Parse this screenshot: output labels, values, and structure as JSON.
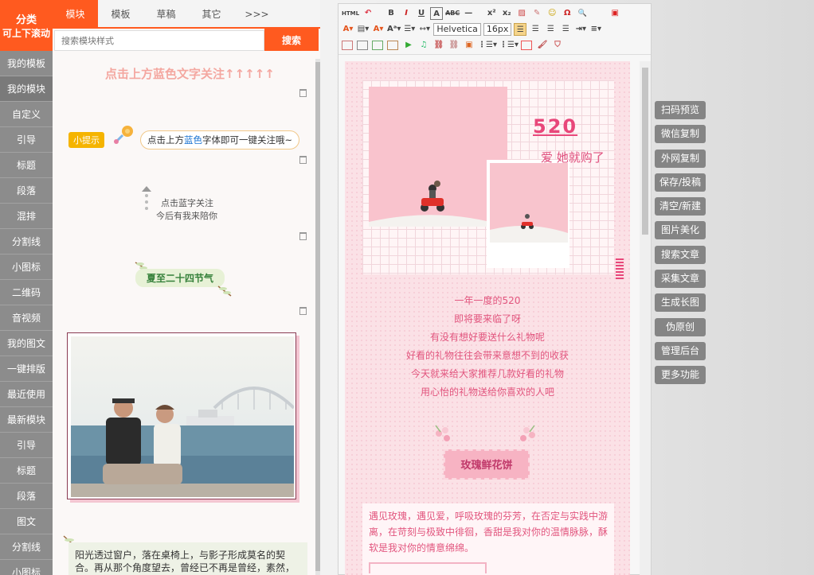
{
  "category": {
    "header_line1": "分类",
    "header_line2": "可上下滚动",
    "items": [
      "我的模板",
      "我的模块",
      "自定义",
      "引导",
      "标题",
      "段落",
      "混排",
      "分割线",
      "小图标",
      "二维码",
      "音视频",
      "我的图文",
      "一键排版",
      "最近使用",
      "最新模块",
      "引导",
      "标题",
      "段落",
      "图文",
      "分割线",
      "小图标"
    ]
  },
  "module_panel": {
    "tabs": [
      "模块",
      "模板",
      "草稿",
      "其它",
      ">>>"
    ],
    "search_placeholder": "搜索模块样式",
    "search_button": "搜索",
    "item1_text": "点击上方蓝色文字关注↑↑↑↑↑",
    "item2_badge": "小提示",
    "item2_pre": "点击上方",
    "item2_blue1": "蓝",
    "item2_blue2": "色",
    "item2_post": "字体即可一键关注哦~",
    "item3_line1": "点击蓝字关注",
    "item3_line2": "今后有我来陪你",
    "item4_text": "夏至二十四节气",
    "item6_text": "阳光透过窗户，落在桌椅上，与影子形成莫名的契合。再从那个角度望去，曾经已不再是曾经，素然，才想起自己已经长大了，回不去了。"
  },
  "editor": {
    "font_family": "Helvetica",
    "font_size": "16px",
    "toolbar_row1": [
      "HTML",
      "↶",
      "B",
      "I",
      "U",
      "A",
      "ABC",
      "—",
      "x²",
      "x₂",
      "▨",
      "✎",
      "☺",
      "Ω",
      "🔍"
    ],
    "article": {
      "num": "520",
      "subtitle": "爱 她就购了",
      "poem": [
        "一年一度的520",
        "即将要来临了呀",
        "有没有想好要送什么礼物呢",
        "好看的礼物往往会带来意想不到的收获",
        "今天就来给大家推荐几款好看的礼物",
        "用心怡的礼物送给你喜欢的人吧"
      ],
      "product": "玫瑰鲜花饼",
      "paragraph": "遇见玫瑰，遇见爱，呼吸玫瑰的芬芳，在否定与实践中游离，在苛刻与极致中徘徊，香甜是我对你的温情脉脉，酥软是我对你的情意绵绵。"
    }
  },
  "actions": [
    "扫码预览",
    "微信复制",
    "外网复制",
    "保存/投稿",
    "清空/新建",
    "图片美化",
    "搜索文章",
    "采集文章",
    "生成长图",
    "伪原创",
    "管理后台",
    "更多功能"
  ],
  "colors": {
    "accent": "#ff5a1f",
    "pink": "#e8477a",
    "gray_button": "#858585"
  }
}
